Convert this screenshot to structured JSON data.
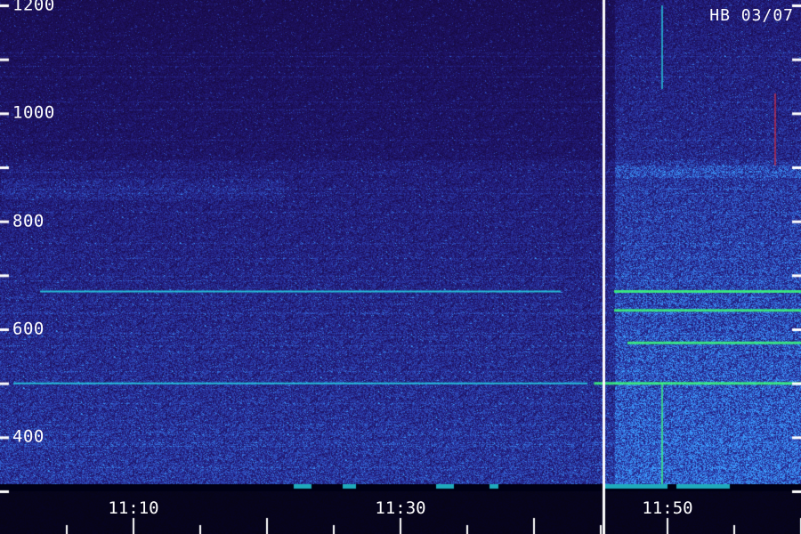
{
  "chart_data": {
    "type": "heatmap",
    "title": "",
    "xlabel": "",
    "ylabel": "",
    "annotation": "HB 03/07",
    "y_tick_labels": [
      "1200",
      "1000",
      "800",
      "600",
      "400"
    ],
    "y_tick_values": [
      1200,
      1000,
      800,
      600,
      400
    ],
    "ylim": [
      300,
      1200
    ],
    "x_tick_labels": [
      "11:10",
      "11:30",
      "11:50"
    ],
    "x_tick_minutes": [
      10,
      30,
      50
    ],
    "xlim_minutes": [
      1,
      60
    ],
    "gap_minutes": 44,
    "colors": {
      "background": "#0b0830",
      "noise_low": "#1a1290",
      "noise_high": "#3f7fff",
      "line_cyan": "#27d6e6",
      "line_green": "#3dff7a",
      "axis": "#ffffff",
      "marker_red": "#ff3030"
    },
    "bright_lines": [
      {
        "freq": 500,
        "from_min": 1,
        "to_min": 44,
        "color": "line_cyan"
      },
      {
        "freq": 500,
        "from_min": 44.5,
        "to_min": 60,
        "color": "line_green"
      },
      {
        "freq": 670,
        "from_min": 3,
        "to_min": 42,
        "color": "line_cyan"
      },
      {
        "freq": 670,
        "from_min": 46,
        "to_min": 60,
        "color": "line_green"
      },
      {
        "freq": 635,
        "from_min": 46,
        "to_min": 60,
        "color": "line_green"
      },
      {
        "freq": 575,
        "from_min": 47,
        "to_min": 60,
        "color": "line_green"
      }
    ]
  }
}
